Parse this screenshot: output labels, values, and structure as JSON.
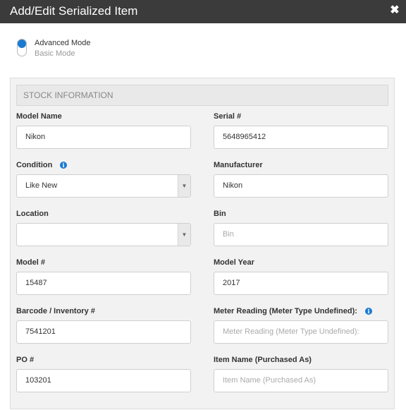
{
  "window": {
    "title": "Add/Edit Serialized Item",
    "close_icon": "close-icon"
  },
  "mode": {
    "primary": "Advanced Mode",
    "secondary": "Basic Mode",
    "selected": "Advanced Mode"
  },
  "section": {
    "title": "STOCK INFORMATION"
  },
  "fields": {
    "model_name": {
      "label": "Model Name",
      "value": "Nikon"
    },
    "serial": {
      "label": "Serial #",
      "value": "5648965412"
    },
    "condition": {
      "label": "Condition",
      "value": "Like New"
    },
    "manufacturer": {
      "label": "Manufacturer",
      "value": "Nikon"
    },
    "location": {
      "label": "Location",
      "value": ""
    },
    "bin": {
      "label": "Bin",
      "placeholder": "Bin"
    },
    "model_number": {
      "label": "Model #",
      "value": "15487"
    },
    "model_year": {
      "label": "Model Year",
      "value": "2017"
    },
    "barcode": {
      "label": "Barcode / Inventory #",
      "value": "7541201"
    },
    "meter_reading": {
      "label": "Meter Reading (Meter Type Undefined):",
      "placeholder": "Meter Reading (Meter Type Undefined):"
    },
    "po_number": {
      "label": "PO #",
      "value": "103201"
    },
    "item_name": {
      "label": "Item Name (Purchased As)",
      "placeholder": "Item Name (Purchased As)"
    }
  },
  "icons": {
    "info": "i",
    "dropdown": "▼"
  },
  "colors": {
    "titlebar": "#3b3b3b",
    "accent": "#1a7ad2"
  }
}
